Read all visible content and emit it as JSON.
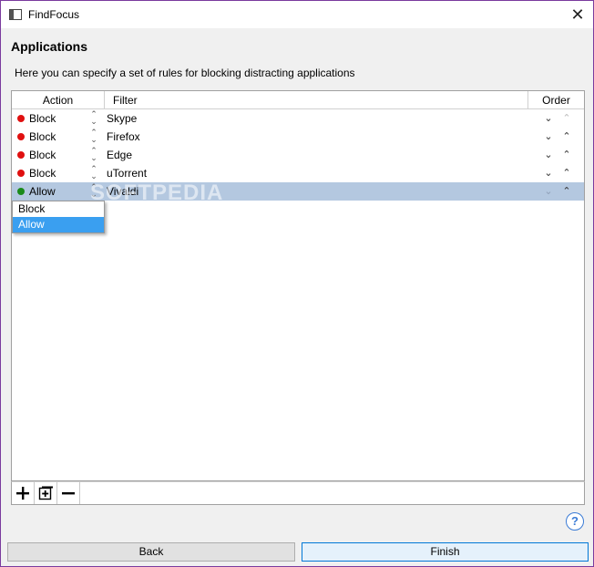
{
  "window": {
    "title": "FindFocus"
  },
  "header": {
    "title": "Applications",
    "description": "Here you can specify a set of rules for blocking distracting applications"
  },
  "table": {
    "columns": [
      "Action",
      "Filter",
      "Order"
    ],
    "rows": [
      {
        "action": "Block",
        "filter": "Skype",
        "status_color": "#e01010",
        "up_enabled": false
      },
      {
        "action": "Block",
        "filter": "Firefox",
        "status_color": "#e01010",
        "up_enabled": true
      },
      {
        "action": "Block",
        "filter": "Edge",
        "status_color": "#e01010",
        "up_enabled": true
      },
      {
        "action": "Block",
        "filter": "uTorrent",
        "status_color": "#e01010",
        "up_enabled": true
      },
      {
        "action": "Allow",
        "filter": "Vivaldi",
        "status_color": "#1a8a1a",
        "up_enabled": true,
        "selected": true
      }
    ]
  },
  "dropdown": {
    "options": [
      "Block",
      "Allow"
    ],
    "highlighted": "Allow"
  },
  "toolbar": {
    "icons": [
      "add-icon",
      "add-from-list-icon",
      "remove-icon"
    ]
  },
  "watermark": "SOFTPEDIA",
  "buttons": {
    "help": "?",
    "back": "Back",
    "finish": "Finish"
  }
}
